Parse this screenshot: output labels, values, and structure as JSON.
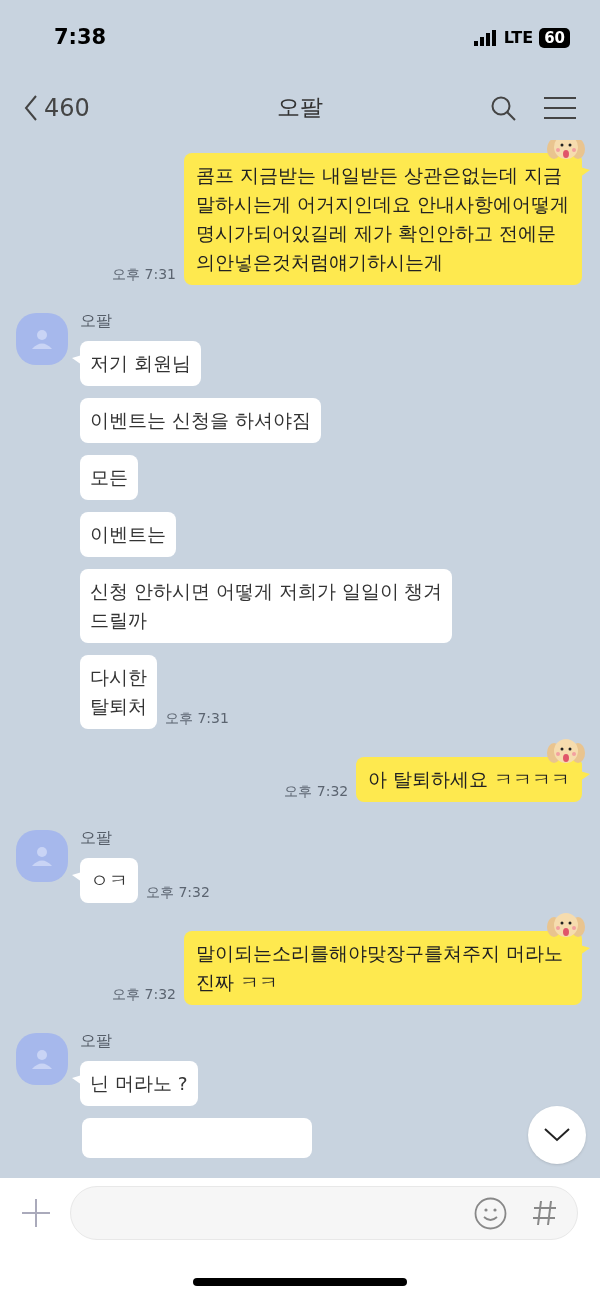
{
  "status_bar": {
    "time": "7:38",
    "network": "LTE",
    "battery": "60"
  },
  "header": {
    "back_count": "460",
    "title": "오팔"
  },
  "messages": [
    {
      "kind": "sent",
      "sticker": true,
      "bubbles": [
        "콤프 지금받는 내일받든 상관은없는데 지금 말하시는게 어거지인데요 안내사항에어떻게명시가되어있길레 제가 확인안하고 전에문의안넣은것처럼얘기하시는게"
      ],
      "time": "오후 7:31"
    },
    {
      "kind": "received",
      "sender": "오팔",
      "bubbles": [
        "저기 회원님",
        "이벤트는 신청을 하셔야짐",
        "모든",
        "이벤트는",
        "신청 안하시면 어떻게 저희가 일일이 챙겨\n드릴까",
        "다시한\n탈퇴처"
      ],
      "time": "오후 7:31"
    },
    {
      "kind": "sent",
      "sticker": true,
      "bubbles": [
        "아 탈퇴하세요 ㅋㅋㅋㅋ"
      ],
      "time": "오후 7:32"
    },
    {
      "kind": "received",
      "sender": "오팔",
      "bubbles": [
        "ㅇㅋ"
      ],
      "time": "오후 7:32"
    },
    {
      "kind": "sent",
      "sticker": true,
      "bubbles": [
        "말이되는소리를해야맞장구를쳐주지 머라노진짜 ㅋㅋ"
      ],
      "time": "오후 7:32"
    },
    {
      "kind": "received",
      "sender": "오팔",
      "bubbles": [
        "닌 머라노 ?"
      ]
    }
  ]
}
